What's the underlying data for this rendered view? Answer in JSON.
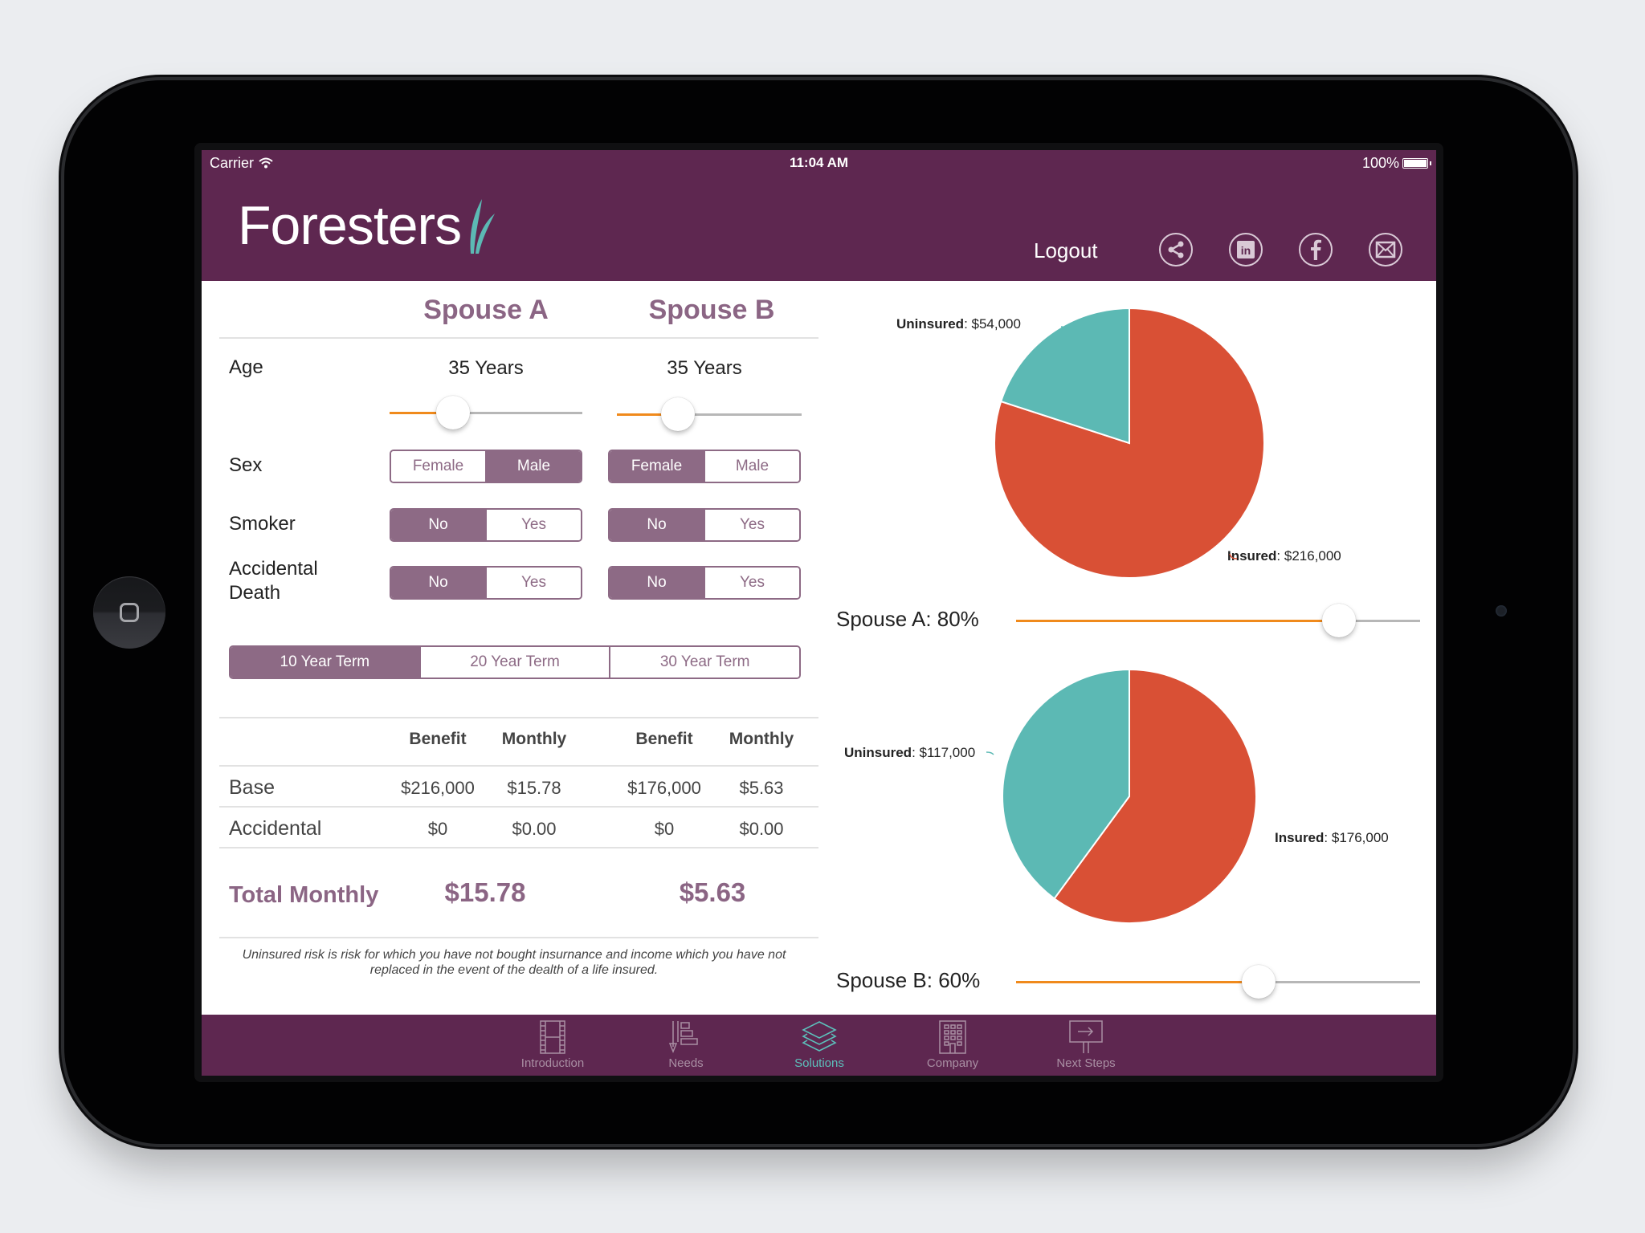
{
  "status_bar": {
    "carrier": "Carrier",
    "time": "11:04 AM",
    "battery": "100%"
  },
  "header": {
    "brand": "Foresters",
    "logout_label": "Logout",
    "icons": [
      "share-icon",
      "linkedin-icon",
      "facebook-icon",
      "email-icon"
    ]
  },
  "form": {
    "columns": [
      "Spouse A",
      "Spouse B"
    ],
    "rows": {
      "age_label": "Age",
      "sex_label": "Sex",
      "smoker_label": "Smoker",
      "accidental_label": "Accidental Death"
    },
    "spouse_a": {
      "age": "35 Years",
      "age_slider_fraction": 0.33,
      "sex": {
        "options": [
          "Female",
          "Male"
        ],
        "selected": "Male"
      },
      "smoker": {
        "options": [
          "No",
          "Yes"
        ],
        "selected": "No"
      },
      "accidental": {
        "options": [
          "No",
          "Yes"
        ],
        "selected": "No"
      }
    },
    "spouse_b": {
      "age": "35 Years",
      "age_slider_fraction": 0.33,
      "sex": {
        "options": [
          "Female",
          "Male"
        ],
        "selected": "Female"
      },
      "smoker": {
        "options": [
          "No",
          "Yes"
        ],
        "selected": "No"
      },
      "accidental": {
        "options": [
          "No",
          "Yes"
        ],
        "selected": "No"
      }
    },
    "term": {
      "options": [
        "10 Year Term",
        "20 Year Term",
        "30 Year Term"
      ],
      "selected": "10 Year Term"
    }
  },
  "table": {
    "headers": [
      "Benefit",
      "Monthly",
      "Benefit",
      "Monthly"
    ],
    "rows": [
      {
        "label": "Base",
        "values": [
          "$216,000",
          "$15.78",
          "$176,000",
          "$5.63"
        ]
      },
      {
        "label": "Accidental",
        "values": [
          "$0",
          "$0.00",
          "$0",
          "$0.00"
        ]
      }
    ],
    "total_label": "Total Monthly",
    "total_a": "$15.78",
    "total_b": "$5.63"
  },
  "disclaimer": "Uninsured risk is risk for which you have not bought insurnance and income which you have not replaced in the event of the dealth of a life insured.",
  "chart_data": [
    {
      "type": "pie",
      "title": "Spouse A",
      "slices": [
        {
          "label": "Insured",
          "value": 216000,
          "display": "$216,000",
          "color": "#d95035"
        },
        {
          "label": "Uninsured",
          "value": 54000,
          "display": "$54,000",
          "color": "#5cb9b4"
        }
      ]
    },
    {
      "type": "pie",
      "title": "Spouse B",
      "slices": [
        {
          "label": "Insured",
          "value": 176000,
          "display": "$176,000",
          "color": "#d95035"
        },
        {
          "label": "Uninsured",
          "value": 117000,
          "display": "$117,000",
          "color": "#5cb9b4"
        }
      ]
    }
  ],
  "coverage": {
    "spouse_a": {
      "label": "Spouse A: 80%",
      "fraction": 0.8
    },
    "spouse_b": {
      "label": "Spouse B: 60%",
      "fraction": 0.6
    }
  },
  "tabbar": {
    "items": [
      {
        "label": "Introduction",
        "icon": "film-icon"
      },
      {
        "label": "Needs",
        "icon": "needs-icon"
      },
      {
        "label": "Solutions",
        "icon": "layers-icon"
      },
      {
        "label": "Company",
        "icon": "building-icon"
      },
      {
        "label": "Next Steps",
        "icon": "sign-arrow-icon"
      }
    ],
    "active": "Solutions"
  },
  "colors": {
    "brand_purple": "#5e2750",
    "accent_purple": "#8d6a85",
    "slider_orange": "#f08a1c",
    "teal": "#5cb9b4",
    "red": "#d95035"
  }
}
